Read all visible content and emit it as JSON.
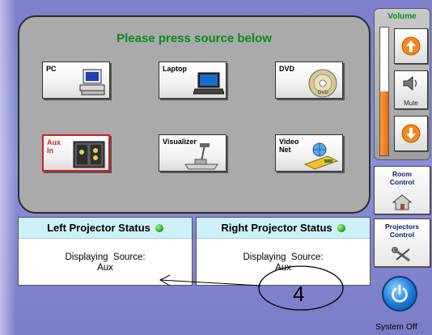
{
  "source_panel": {
    "title": "Please press source below",
    "sources": [
      {
        "id": "pc",
        "label": "PC",
        "active": false,
        "icon": "computer-icon"
      },
      {
        "id": "laptop",
        "label": "Laptop",
        "active": false,
        "icon": "laptop-icon"
      },
      {
        "id": "dvd",
        "label": "DVD",
        "active": false,
        "icon": "dvd-disc-icon"
      },
      {
        "id": "aux",
        "label": "Aux\nIn",
        "active": true,
        "icon": "aux-input-icon"
      },
      {
        "id": "visualizer",
        "label": "Visualizer",
        "active": false,
        "icon": "document-camera-icon"
      },
      {
        "id": "videonet",
        "label": "Video\nNet",
        "active": false,
        "icon": "video-network-icon"
      }
    ]
  },
  "left_projector": {
    "title": "Left Projector Status",
    "line1": "Displaying  Source:",
    "line2": "Aux",
    "status_color": "#1c9a12"
  },
  "right_projector": {
    "title": "Right Projector Status",
    "line1": "Displaying  Source:",
    "line2": "Aux",
    "status_color": "#1c9a12"
  },
  "volume": {
    "title": "Volume",
    "level": 0.5,
    "mute_label": "Mute",
    "up_icon": "arrow-up-icon",
    "down_icon": "arrow-down-icon"
  },
  "room_control": {
    "label": "Room\nControl",
    "icon": "house-icon"
  },
  "projectors_control": {
    "label": "Projectors\nControl",
    "icon": "tools-icon"
  },
  "system_off": {
    "label": "System Off",
    "icon": "power-icon"
  },
  "annotation": {
    "number": "4"
  },
  "colors": {
    "accent_green": "#0b8a1c",
    "background": "#7f7fc9",
    "active_border": "#d42020"
  }
}
